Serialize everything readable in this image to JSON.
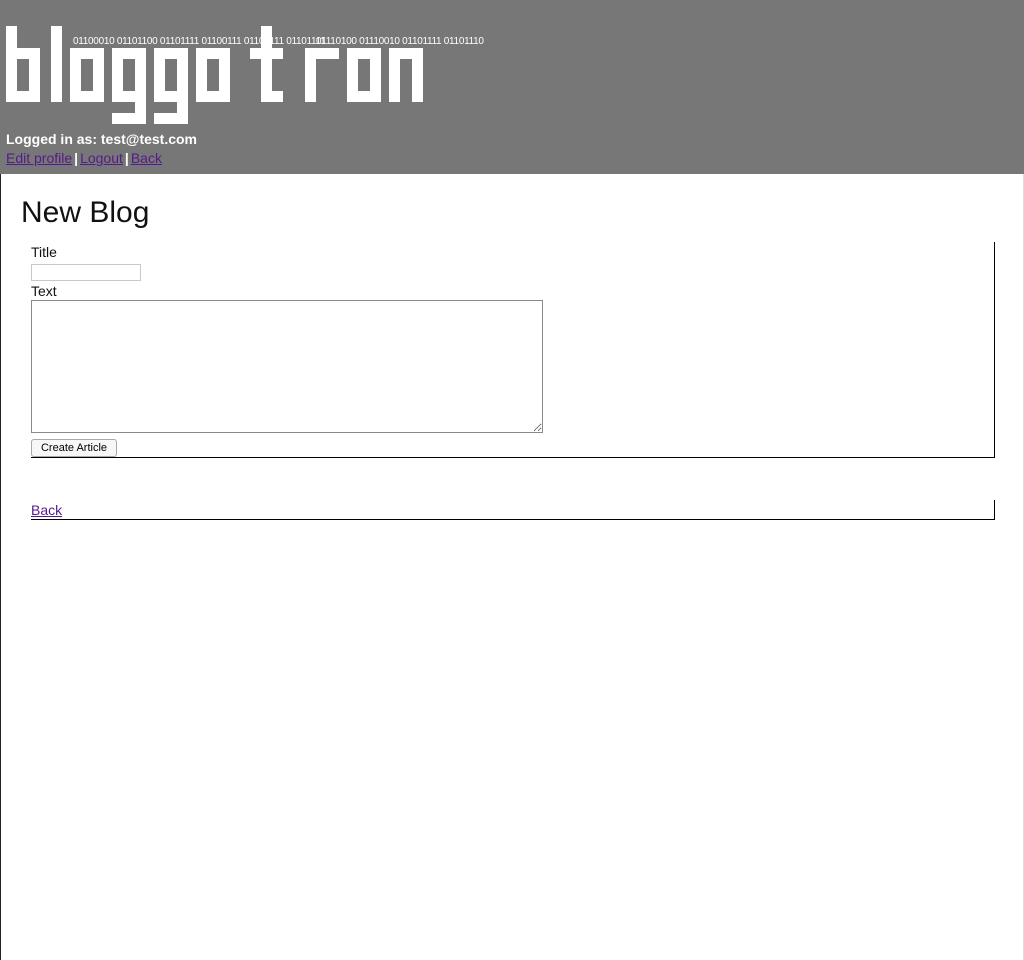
{
  "header": {
    "logo_text": "bloggotron",
    "binary_left": "01100010 01101100 01101111 01100111 01100111 01101111",
    "binary_right": "01110100 01110010 01101111 01101110",
    "logged_in": "Logged in as: test@test.com",
    "nav": {
      "edit_profile": "Edit profile",
      "logout": "Logout",
      "back": "Back",
      "separator": "|"
    }
  },
  "main": {
    "title": "New Blog",
    "form": {
      "title_label": "Title",
      "title_value": "",
      "text_label": "Text",
      "text_value": "",
      "submit_label": "Create Article"
    },
    "back_link": "Back"
  },
  "colors": {
    "header_bg": "#777777",
    "link": "#551a8b",
    "logo": "#ffffff"
  }
}
